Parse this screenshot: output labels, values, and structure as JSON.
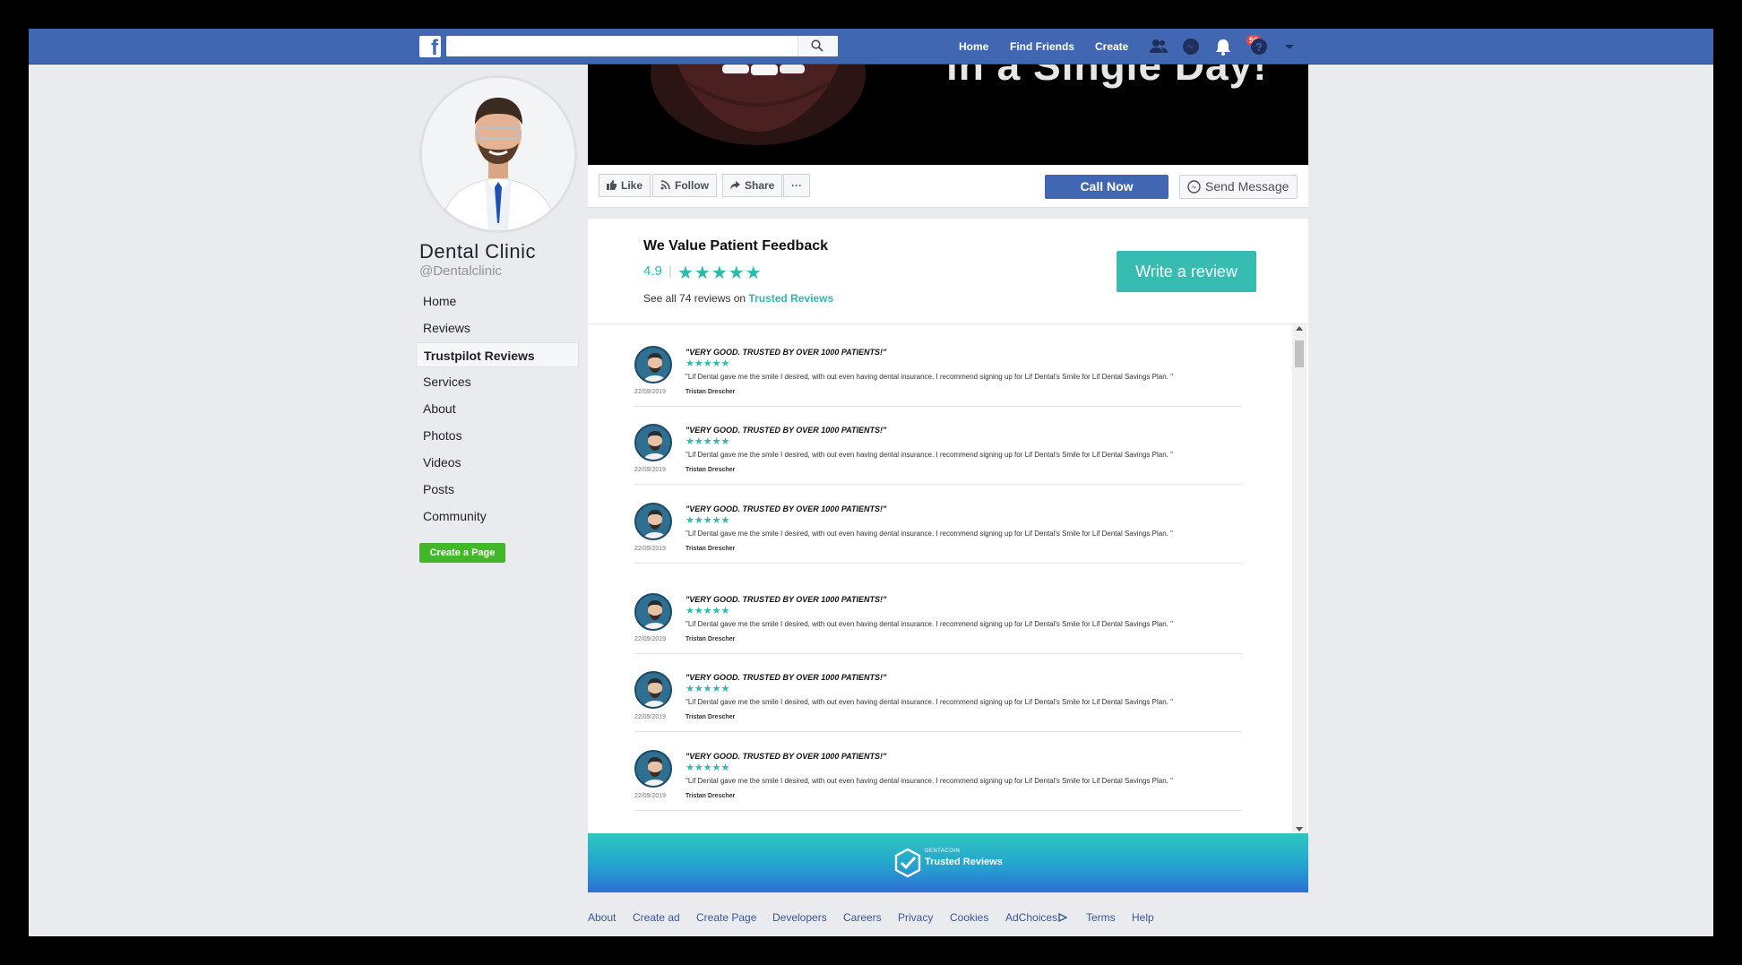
{
  "topbar": {
    "search": {
      "placeholder": "",
      "value": ""
    },
    "nav": [
      "Home",
      "Find Friends",
      "Create"
    ],
    "notifications_count": "56",
    "icons": [
      "friends-icon",
      "messenger-icon",
      "notifications-icon",
      "help-icon",
      "dropdown-icon"
    ],
    "brand_color": "#4267b2"
  },
  "page": {
    "name": "Dental Clinic",
    "handle": "@Dentalclinic"
  },
  "sidebar": {
    "items": [
      {
        "label": "Home",
        "active": false
      },
      {
        "label": "Reviews",
        "active": false
      },
      {
        "label": "Trustpilot Reviews",
        "active": true
      },
      {
        "label": "Services",
        "active": false
      },
      {
        "label": "About",
        "active": false
      },
      {
        "label": "Photos",
        "active": false
      },
      {
        "label": "Videos",
        "active": false
      },
      {
        "label": "Posts",
        "active": false
      },
      {
        "label": "Community",
        "active": false
      }
    ],
    "create_page": "Create a Page"
  },
  "cover": {
    "text": "in a Single Day!"
  },
  "actions": {
    "like": "Like",
    "follow": "Follow",
    "share": "Share",
    "more": "···",
    "call_now": "Call Now",
    "send_message": "Send Message"
  },
  "feedback": {
    "title": "We Value Patient Feedback",
    "score": "4.9",
    "separator": "|",
    "stars": "★★★★★",
    "sub_text": "See all 74 reviews on ",
    "sub_link": "Trusted Reviews",
    "write_review": "Write a review",
    "accent": "#2bbbad"
  },
  "reviews": [
    {
      "date": "22/09/2019",
      "title": "\"VERY GOOD. TRUSTED BY OVER 1000 PATIENTS!\"",
      "stars": "★★★★★",
      "text": "\"Lif Dental gave me the smile I desired, with out even having dental insurance. I recommend signing up for Lif Dental's Smile for Lif Dental Savings Plan. \"",
      "author": "Tristan Drescher"
    },
    {
      "date": "22/09/2019",
      "title": "\"VERY GOOD. TRUSTED BY OVER 1000 PATIENTS!\"",
      "stars": "★★★★★",
      "text": "\"Lif Dental gave me the smile I desired, with out even having dental insurance. I recommend signing up for Lif Dental's Smile for Lif Dental Savings Plan. \"",
      "author": "Tristan Drescher"
    },
    {
      "date": "22/09/2019",
      "title": "\"VERY GOOD. TRUSTED BY OVER 1000 PATIENTS!\"",
      "stars": "★★★★★",
      "text": "\"Lif Dental gave me the smile I desired, with out even having dental insurance. I recommend signing up for Lif Dental's Smile for Lif Dental Savings Plan. \"",
      "author": "Tristan Drescher"
    },
    {
      "date": "22/09/2019",
      "title": "\"VERY GOOD. TRUSTED BY OVER 1000 PATIENTS!\"",
      "stars": "★★★★★",
      "text": "\"Lif Dental gave me the smile I desired, with out even having dental insurance. I recommend signing up for Lif Dental's Smile for Lif Dental Savings Plan. \"",
      "author": "Tristan Drescher"
    },
    {
      "date": "22/09/2019",
      "title": "\"VERY GOOD. TRUSTED BY OVER 1000 PATIENTS!\"",
      "stars": "★★★★★",
      "text": "\"Lif Dental gave me the smile I desired, with out even having dental insurance. I recommend signing up for Lif Dental's Smile for Lif Dental Savings Plan. \"",
      "author": "Tristan Drescher"
    },
    {
      "date": "22/09/2019",
      "title": "\"VERY GOOD. TRUSTED BY OVER 1000 PATIENTS!\"",
      "stars": "★★★★★",
      "text": "\"Lif Dental gave me the smile I desired, with out even having dental insurance. I recommend signing up for Lif Dental's Smile for Lif Dental Savings Plan. \"",
      "author": "Tristan Drescher"
    }
  ],
  "banner": {
    "small": "DENTACOIN",
    "title": "Trusted Reviews"
  },
  "footer": [
    "About",
    "Create ad",
    "Create Page",
    "Developers",
    "Careers",
    "Privacy",
    "Cookies",
    "AdChoices",
    "Terms",
    "Help"
  ]
}
